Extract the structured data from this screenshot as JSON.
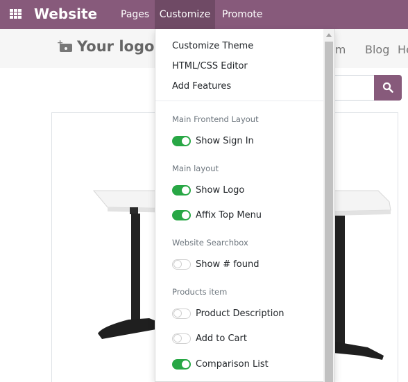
{
  "topbar": {
    "app_title": "Website",
    "menu": [
      "Pages",
      "Customize",
      "Promote"
    ],
    "color": "#875a7b",
    "active_color": "#6f4a65"
  },
  "site_header": {
    "logo_text": "Your logo",
    "nav": [
      "rum",
      "Blog",
      "He"
    ]
  },
  "search": {
    "button_icon": "search-icon",
    "button_color": "#875a7b"
  },
  "customize_menu": {
    "items": [
      "Customize Theme",
      "HTML/CSS Editor",
      "Add Features"
    ],
    "sections": [
      {
        "header": "Main Frontend Layout",
        "options": [
          {
            "label": "Show Sign In",
            "enabled": true
          }
        ]
      },
      {
        "header": "Main layout",
        "options": [
          {
            "label": "Show Logo",
            "enabled": true
          },
          {
            "label": "Affix Top Menu",
            "enabled": true
          }
        ]
      },
      {
        "header": "Website Searchbox",
        "options": [
          {
            "label": "Show # found",
            "enabled": false
          }
        ]
      },
      {
        "header": "Products item",
        "options": [
          {
            "label": "Product Description",
            "enabled": false
          },
          {
            "label": "Add to Cart",
            "enabled": false
          },
          {
            "label": "Comparison List",
            "enabled": true
          }
        ]
      }
    ],
    "toggle_on_color": "#28a745"
  }
}
